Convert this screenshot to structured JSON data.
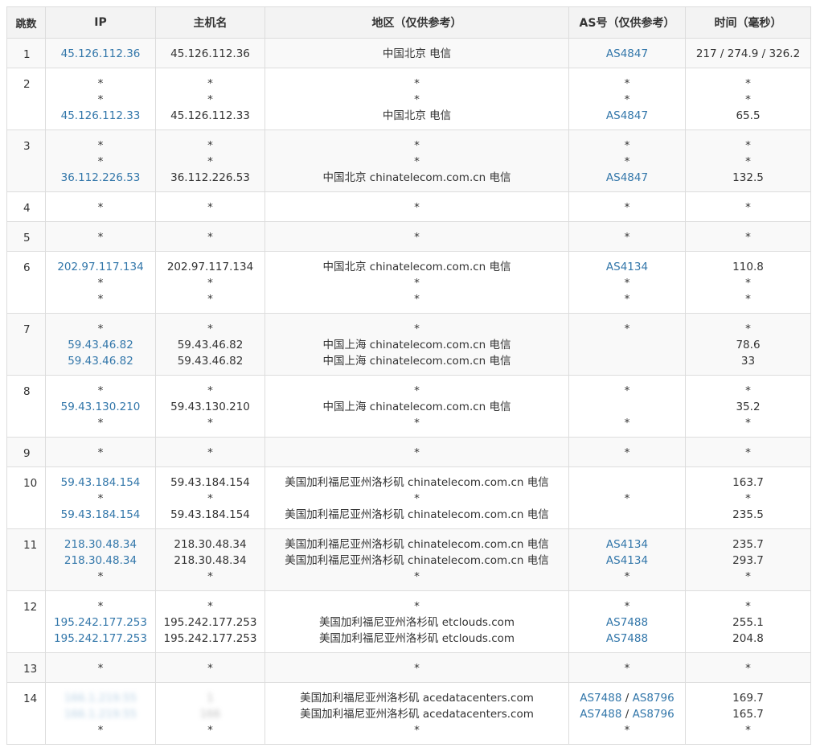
{
  "headers": {
    "hop": "跳数",
    "ip": "IP",
    "host": "主机名",
    "region": "地区（仅供参考）",
    "as": "AS号（仅供参考）",
    "time": "时间（毫秒）"
  },
  "rows": [
    {
      "hop": "1",
      "ip": [
        "45.126.112.36"
      ],
      "host": [
        "45.126.112.36"
      ],
      "region": [
        "中国北京 电信"
      ],
      "as": [
        "AS4847"
      ],
      "time": [
        "217 / 274.9 / 326.2"
      ]
    },
    {
      "hop": "2",
      "ip": [
        "*",
        "*",
        "45.126.112.33"
      ],
      "host": [
        "*",
        "*",
        "45.126.112.33"
      ],
      "region": [
        "*",
        "*",
        "中国北京 电信"
      ],
      "as": [
        "*",
        "*",
        "AS4847"
      ],
      "time": [
        "*",
        "*",
        "65.5"
      ]
    },
    {
      "hop": "3",
      "ip": [
        "*",
        "*",
        "36.112.226.53"
      ],
      "host": [
        "*",
        "*",
        "36.112.226.53"
      ],
      "region": [
        "*",
        "*",
        "中国北京 chinatelecom.com.cn 电信"
      ],
      "as": [
        "*",
        "*",
        "AS4847"
      ],
      "time": [
        "*",
        "*",
        "132.5"
      ]
    },
    {
      "hop": "4",
      "ip": [
        "*"
      ],
      "host": [
        "*"
      ],
      "region": [
        "*"
      ],
      "as": [
        "*"
      ],
      "time": [
        "*"
      ]
    },
    {
      "hop": "5",
      "ip": [
        "*"
      ],
      "host": [
        "*"
      ],
      "region": [
        "*"
      ],
      "as": [
        "*"
      ],
      "time": [
        "*"
      ]
    },
    {
      "hop": "6",
      "ip": [
        "202.97.117.134",
        "*",
        "*"
      ],
      "host": [
        "202.97.117.134",
        "*",
        "*"
      ],
      "region": [
        "中国北京 chinatelecom.com.cn 电信",
        "*",
        "*"
      ],
      "as": [
        "AS4134",
        "*",
        "*"
      ],
      "time": [
        "110.8",
        "*",
        "*"
      ]
    },
    {
      "hop": "7",
      "ip": [
        "*",
        "59.43.46.82",
        "59.43.46.82"
      ],
      "host": [
        "*",
        "59.43.46.82",
        "59.43.46.82"
      ],
      "region": [
        "*",
        "中国上海 chinatelecom.com.cn 电信",
        "中国上海 chinatelecom.com.cn 电信"
      ],
      "as": [
        "*",
        "",
        ""
      ],
      "time": [
        "*",
        "78.6",
        "33"
      ]
    },
    {
      "hop": "8",
      "ip": [
        "*",
        "59.43.130.210",
        "*"
      ],
      "host": [
        "*",
        "59.43.130.210",
        "*"
      ],
      "region": [
        "*",
        "中国上海 chinatelecom.com.cn 电信",
        "*"
      ],
      "as": [
        "*",
        "",
        "*"
      ],
      "time": [
        "*",
        "35.2",
        "*"
      ]
    },
    {
      "hop": "9",
      "ip": [
        "*"
      ],
      "host": [
        "*"
      ],
      "region": [
        "*"
      ],
      "as": [
        "*"
      ],
      "time": [
        "*"
      ]
    },
    {
      "hop": "10",
      "ip": [
        "59.43.184.154",
        "*",
        "59.43.184.154"
      ],
      "host": [
        "59.43.184.154",
        "*",
        "59.43.184.154"
      ],
      "region": [
        "美国加利福尼亚州洛杉矶 chinatelecom.com.cn 电信",
        "*",
        "美国加利福尼亚州洛杉矶 chinatelecom.com.cn 电信"
      ],
      "as": [
        "",
        "*",
        ""
      ],
      "time": [
        "163.7",
        "*",
        "235.5"
      ]
    },
    {
      "hop": "11",
      "ip": [
        "218.30.48.34",
        "218.30.48.34",
        "*"
      ],
      "host": [
        "218.30.48.34",
        "218.30.48.34",
        "*"
      ],
      "region": [
        "美国加利福尼亚州洛杉矶 chinatelecom.com.cn 电信",
        "美国加利福尼亚州洛杉矶 chinatelecom.com.cn 电信",
        "*"
      ],
      "as": [
        "AS4134",
        "AS4134",
        "*"
      ],
      "time": [
        "235.7",
        "293.7",
        "*"
      ]
    },
    {
      "hop": "12",
      "ip": [
        "*",
        "195.242.177.253",
        "195.242.177.253"
      ],
      "host": [
        "*",
        "195.242.177.253",
        "195.242.177.253"
      ],
      "region": [
        "*",
        "美国加利福尼亚州洛杉矶 etclouds.com",
        "美国加利福尼亚州洛杉矶 etclouds.com"
      ],
      "as": [
        "*",
        "AS7488",
        "AS7488"
      ],
      "time": [
        "*",
        "255.1",
        "204.8"
      ]
    },
    {
      "hop": "13",
      "ip": [
        "*"
      ],
      "host": [
        "*"
      ],
      "region": [
        "*"
      ],
      "as": [
        "*"
      ],
      "time": [
        "*"
      ]
    },
    {
      "hop": "14",
      "ip": [
        "166.1.219.55",
        "",
        "*"
      ],
      "host": [
        "1",
        "166",
        "*"
      ],
      "region": [
        "美国加利福尼亚州洛杉矶 acedatacenters.com",
        "美国加利福尼亚州洛杉矶 acedatacenters.com",
        "*"
      ],
      "as": [
        [
          "AS7488",
          "AS8796"
        ],
        [
          "AS7488",
          "AS8796"
        ],
        "*"
      ],
      "time": [
        "169.7",
        "165.7",
        "*"
      ]
    }
  ],
  "colors": {
    "link": "#3377aa",
    "text": "#333333",
    "header_bg": "#f3f3f3",
    "row_alt_bg": "#f9f9f9",
    "border": "#dddddd"
  }
}
